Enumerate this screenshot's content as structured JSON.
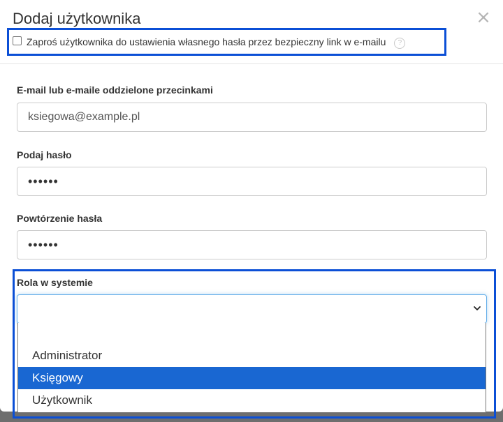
{
  "modal": {
    "title": "Dodaj użytkownika",
    "close_icon": "close-icon",
    "close_glyph": "×"
  },
  "invite": {
    "checked": false,
    "label": "Zaproś użytkownika do ustawienia własnego hasła przez bezpieczny link w e-mailu",
    "help_glyph": "?"
  },
  "form": {
    "email": {
      "label": "E-mail lub e-maile oddzielone przecinkami",
      "value": "ksiegowa@example.pl"
    },
    "password": {
      "label": "Podaj hasło",
      "value": "••••••"
    },
    "password_repeat": {
      "label": "Powtórzenie hasła",
      "value": "••••••"
    },
    "role": {
      "label": "Rola w systemie",
      "value": "",
      "options": [
        "",
        "Administrator",
        "Księgowy",
        "Użytkownik"
      ],
      "highlighted_option": "Księgowy"
    }
  },
  "colors": {
    "highlight_border": "#0b4fd6",
    "option_highlight": "#1967d2",
    "focus_border": "#66afe9"
  }
}
